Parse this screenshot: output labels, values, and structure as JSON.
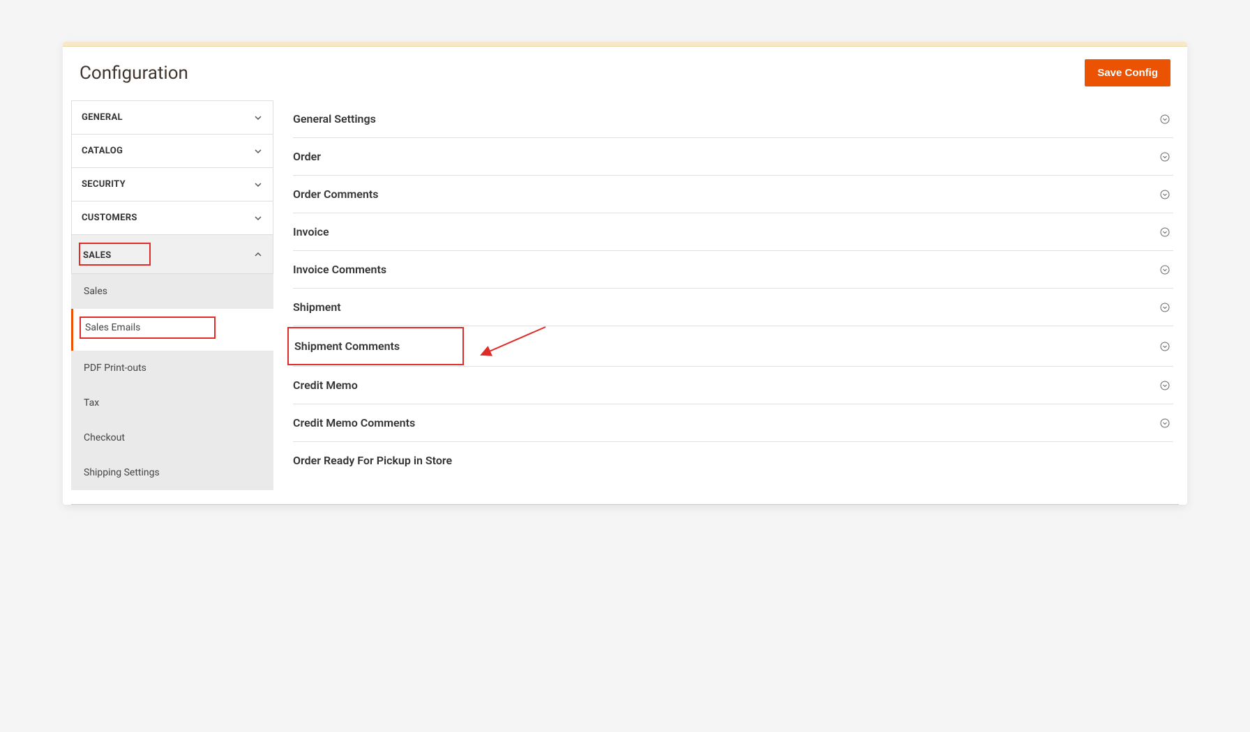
{
  "header": {
    "page_title": "Configuration",
    "save_button_label": "Save Config"
  },
  "sidebar": {
    "items": [
      {
        "label": "GENERAL",
        "expanded": false
      },
      {
        "label": "CATALOG",
        "expanded": false
      },
      {
        "label": "SECURITY",
        "expanded": false
      },
      {
        "label": "CUSTOMERS",
        "expanded": false
      },
      {
        "label": "SALES",
        "expanded": true,
        "sub_items": [
          {
            "label": "Sales",
            "active": false
          },
          {
            "label": "Sales Emails",
            "active": true
          },
          {
            "label": "PDF Print-outs",
            "active": false
          },
          {
            "label": "Tax",
            "active": false
          },
          {
            "label": "Checkout",
            "active": false
          },
          {
            "label": "Shipping Settings",
            "active": false
          }
        ]
      }
    ]
  },
  "sections": [
    {
      "label": "General Settings"
    },
    {
      "label": "Order"
    },
    {
      "label": "Order Comments"
    },
    {
      "label": "Invoice"
    },
    {
      "label": "Invoice Comments"
    },
    {
      "label": "Shipment"
    },
    {
      "label": "Shipment Comments"
    },
    {
      "label": "Credit Memo"
    },
    {
      "label": "Credit Memo Comments"
    },
    {
      "label": "Order Ready For Pickup in Store"
    }
  ],
  "colors": {
    "accent": "#eb5202",
    "highlight_border": "#e02b27",
    "topbar": "#f8e8c8"
  }
}
